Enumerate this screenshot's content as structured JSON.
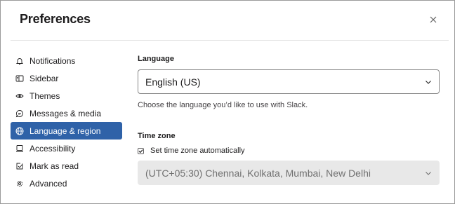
{
  "dialog": {
    "title": "Preferences",
    "close_icon": "close-icon"
  },
  "sidebar": {
    "items": [
      {
        "label": "Notifications",
        "icon": "bell-icon"
      },
      {
        "label": "Sidebar",
        "icon": "sidebar-icon"
      },
      {
        "label": "Themes",
        "icon": "eye-icon"
      },
      {
        "label": "Messages & media",
        "icon": "message-icon"
      },
      {
        "label": "Language & region",
        "icon": "globe-icon",
        "active": true
      },
      {
        "label": "Accessibility",
        "icon": "keyboard-icon"
      },
      {
        "label": "Mark as read",
        "icon": "check-box-icon"
      },
      {
        "label": "Advanced",
        "icon": "gear-icon"
      }
    ]
  },
  "language": {
    "label": "Language",
    "selected": "English (US)",
    "help": "Choose the language you’d like to use with Slack."
  },
  "timezone": {
    "label": "Time zone",
    "auto_label": "Set time zone automatically",
    "auto_checked": true,
    "selected": "(UTC+05:30) Chennai, Kolkata, Mumbai, New Delhi"
  },
  "colors": {
    "accent": "#2f62a8",
    "text": "#1d1c1d",
    "disabled_bg": "#e8e8e8"
  }
}
